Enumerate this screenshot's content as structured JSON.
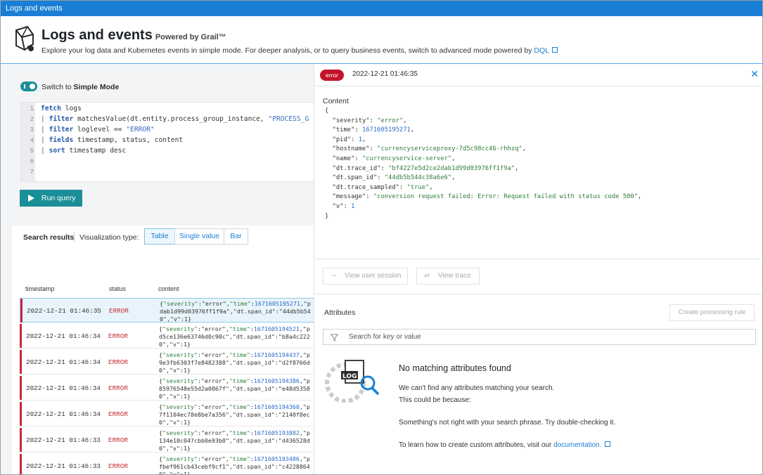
{
  "window": {
    "title": "Logs and events"
  },
  "header": {
    "title": "Logs and events",
    "powered": "Powered by Grail™",
    "subtitle": "Explore your log data and Kubernetes events in simple mode. For deeper analysis, or to query business events, switch to advanced mode powered by",
    "dql_link": "DQL",
    "icon": "logs-app-icon"
  },
  "query": {
    "toggle_prefix": "Switch to",
    "toggle_mode": "Simple Mode",
    "toggle_on": true,
    "line_numbers": [
      "1",
      "2",
      "3",
      "4",
      "5",
      "6",
      "7"
    ],
    "run_label": "Run query"
  },
  "results": {
    "label": "Search results",
    "viz_label": "Visualization type:",
    "viz_options": [
      "Table",
      "Single value",
      "Bar"
    ],
    "viz_selected": "Table",
    "columns": [
      "timestamp",
      "status",
      "content"
    ],
    "rows": [
      {
        "timestamp": "2022-12-21 01:46:35",
        "status": "ERROR",
        "time": "1671605195271",
        "line2": "dab1d99d03976ff1f9a\",\"dt.span_id\":\"44db5b54",
        "line3": "0\",\"v\":1}"
      },
      {
        "timestamp": "2022-12-21 01:46:34",
        "status": "ERROR",
        "time": "1671605194521",
        "line2": "d5ce136e63746d0c90c\",\"dt.span_id\":\"b8a4c222",
        "line3": "0\",\"v\":1}"
      },
      {
        "timestamp": "2022-12-21 01:46:34",
        "status": "ERROR",
        "time": "1671605194437",
        "line2": "9e3fb6303f7e8482388\",\"dt.span_id\":\"d2f8766d",
        "line3": "0\",\"v\":1}"
      },
      {
        "timestamp": "2022-12-21 01:46:34",
        "status": "ERROR",
        "time": "1671605194386",
        "line2": "85976548e55d2a0867f\",\"dt.span_id\":\"e48d5358",
        "line3": "0\",\"v\":1}"
      },
      {
        "timestamp": "2022-12-21 01:46:34",
        "status": "ERROR",
        "time": "1671605194360",
        "line2": "7f1104ec78e8be7a356\",\"dt.span_id\":\"2140f8ec",
        "line3": "0\",\"v\":1}"
      },
      {
        "timestamp": "2022-12-21 01:46:33",
        "status": "ERROR",
        "time": "1671605193882",
        "line2": "134e10c047cbb0e93b0\",\"dt.span_id\":\"d436528d",
        "line3": "0\",\"v\":1}"
      },
      {
        "timestamp": "2022-12-21 01:46:33",
        "status": "ERROR",
        "time": "1671605193486",
        "line2": "fbef961cb43cebf9cf1\",\"dt.span_id\":\"c4228864",
        "line3": "0\",\"v\":1}"
      }
    ]
  },
  "detail": {
    "badge": "error",
    "timestamp": "2022-12-21 01:46:35",
    "content_label": "Content",
    "json": {
      "severity": "error",
      "time": "1671605195271",
      "pid": "1",
      "hostname": "currencyserviceproxy-7d5c98cc46-rhhzq",
      "name": "currencyservice-server",
      "trace_id": "bf4227e5d2ce2dab1d99d03976ff1f9a",
      "span_id": "44db5b544c38a6e6",
      "trace_sampled": "true",
      "message": "conversion request failed: Error: Request failed with status code 500",
      "v": "1"
    },
    "view_user_session": "View user session",
    "view_trace": "View trace",
    "attributes_label": "Attributes",
    "create_rule": "Create processing rule",
    "search_placeholder": "Search for key or value",
    "empty": {
      "title": "No matching attributes found",
      "line1": "We can't find any attributes matching your search.",
      "line2": "This could be because:",
      "line3": "Something's not right with your search phrase. Try double-checking it.",
      "line4": "To learn how to create custom attributes, visit our",
      "link": "documentation."
    }
  },
  "colors": {
    "accent": "#1b8f97",
    "link": "#1a7fd4",
    "error": "#c4132a",
    "titlebar": "#1a7fd4"
  }
}
